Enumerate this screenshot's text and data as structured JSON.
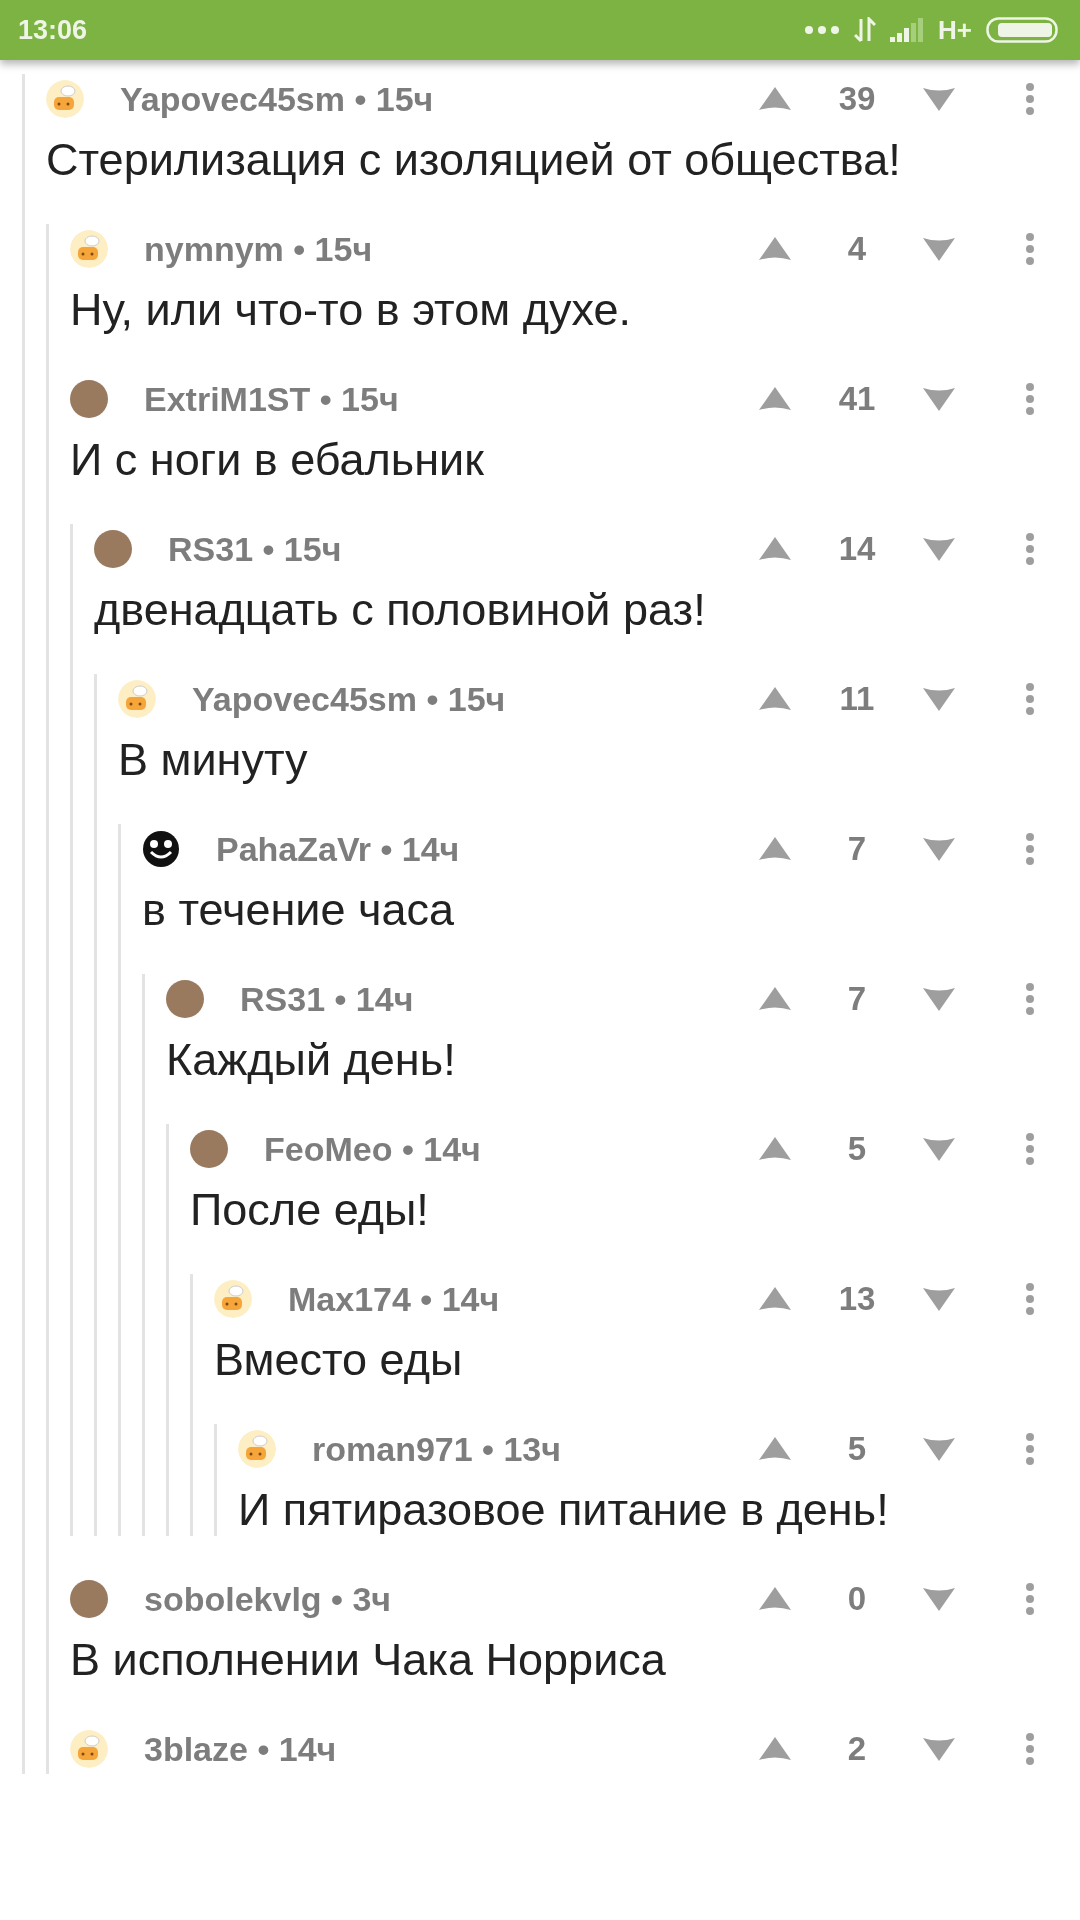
{
  "status_bar": {
    "time": "13:06",
    "network": "H+"
  },
  "comments": [
    {
      "meta": "Yapovec45sm • 15ч",
      "kind": "default",
      "votes": "39",
      "text": "Стерилизация с изоляцией от общества!",
      "children": [
        {
          "meta": "nymnym • 15ч",
          "kind": "default",
          "votes": "4",
          "text": "Ну, или что-то в этом духе."
        },
        {
          "meta": "ExtriM1ST • 15ч",
          "kind": "photo",
          "votes": "41",
          "text": "И с ноги в ебальник",
          "children": [
            {
              "meta": "RS31 • 15ч",
              "kind": "photo",
              "votes": "14",
              "text": "двенадцать с половиной раз!",
              "children": [
                {
                  "meta": "Yapovec45sm • 15ч",
                  "kind": "default",
                  "votes": "11",
                  "text": "В минуту",
                  "children": [
                    {
                      "meta": "PahaZaVr • 14ч",
                      "kind": "smiley",
                      "votes": "7",
                      "text": "в течение часа",
                      "children": [
                        {
                          "meta": "RS31 • 14ч",
                          "kind": "photo",
                          "votes": "7",
                          "text": "Каждый день!",
                          "children": [
                            {
                              "meta": "FeoMeo • 14ч",
                              "kind": "photo",
                              "votes": "5",
                              "text": "После еды!",
                              "children": [
                                {
                                  "meta": "Max174 • 14ч",
                                  "kind": "default",
                                  "votes": "13",
                                  "text": "Вместо еды",
                                  "children": [
                                    {
                                      "meta": "roman971 • 13ч",
                                      "kind": "default",
                                      "votes": "5",
                                      "text": "И пятиразовое питание в день!"
                                    }
                                  ]
                                }
                              ]
                            }
                          ]
                        }
                      ]
                    }
                  ]
                }
              ]
            }
          ]
        },
        {
          "meta": "sobolekvlg • 3ч",
          "kind": "photo",
          "votes": "0",
          "text": "В исполнении Чака Норриса"
        },
        {
          "meta": "3blaze • 14ч",
          "kind": "default",
          "votes": "2"
        }
      ]
    }
  ]
}
